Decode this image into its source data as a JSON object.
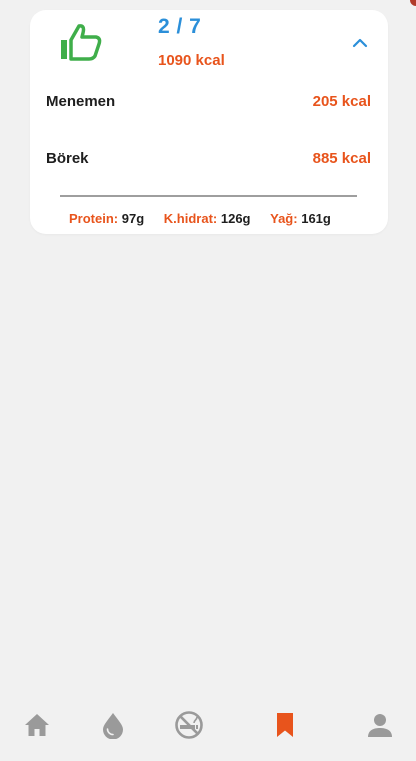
{
  "summary": {
    "count": "2 / 7",
    "total_kcal": "1090 kcal"
  },
  "meals": [
    {
      "name": "Menemen",
      "kcal": "205 kcal"
    },
    {
      "name": "Börek",
      "kcal": "885 kcal"
    }
  ],
  "macros": [
    {
      "label": "Protein:",
      "value": "97g"
    },
    {
      "label": "K.hidrat:",
      "value": "126g"
    },
    {
      "label": "Yağ:",
      "value": "161g"
    }
  ],
  "icons": {
    "status": "thumbs-up-icon",
    "collapse": "chevron-up-icon",
    "nav": [
      "home-icon",
      "water-drop-icon",
      "no-smoking-icon",
      "bookmark-icon",
      "person-icon"
    ]
  },
  "nav": {
    "active_index": 3
  },
  "colors": {
    "accent_orange": "#e8541c",
    "accent_blue": "#2b8fd9",
    "success_green": "#3fae4a",
    "nav_inactive": "#9a9a9a",
    "background": "#f1f1f1"
  }
}
